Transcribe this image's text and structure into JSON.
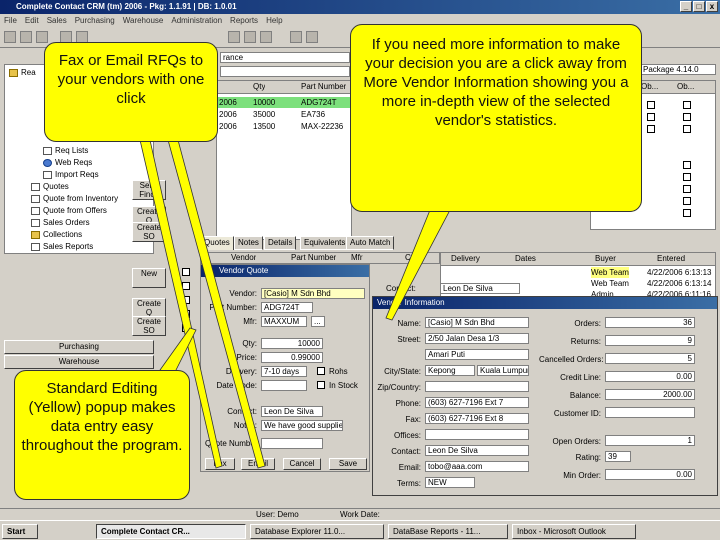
{
  "window": {
    "title": "Complete Contact CRM (tm) 2006 - Pkg: 1.1.91 | DB: 1.0.01",
    "controls": [
      "_",
      "□",
      "x"
    ]
  },
  "menu": [
    "File",
    "Edit",
    "Sales",
    "Purchasing",
    "Warehouse",
    "Administration",
    "Reports",
    "Help"
  ],
  "toolbar_fields": {
    "vendor_filter": "rance",
    "package": "Package 4.14.0"
  },
  "tree": {
    "items": [
      {
        "label": "Rea",
        "icon": "folder"
      },
      {
        "label": "Req Lists",
        "icon": "doc"
      },
      {
        "label": "Web Reqs",
        "icon": "net"
      },
      {
        "label": "Import Reqs",
        "icon": "doc"
      },
      {
        "label": "Quotes",
        "icon": "doc"
      },
      {
        "label": "Quote from Inventory",
        "icon": "doc"
      },
      {
        "label": "Quote from Offers",
        "icon": "doc"
      },
      {
        "label": "Sales Orders",
        "icon": "doc"
      },
      {
        "label": "Collections",
        "icon": "folder"
      },
      {
        "label": "Sales Reports",
        "icon": "doc"
      }
    ]
  },
  "side_buttons": {
    "purchasing": "Purchasing",
    "warehouse": "Warehouse"
  },
  "mid_buttons": [
    "Send Finch",
    "Create Q",
    "Create SO",
    "New",
    "Create Q",
    "Create SO"
  ],
  "grid": {
    "headers": [
      "Qty",
      "Part Number"
    ],
    "rows": [
      {
        "date": "2006",
        "qty": "10000",
        "part": "ADG724T",
        "selected": true
      },
      {
        "date": "2006",
        "qty": "35000",
        "part": "EA736",
        "selected": false
      },
      {
        "date": "2006",
        "qty": "13500",
        "part": "MAX-22236",
        "selected": false
      }
    ]
  },
  "right_grid": {
    "headers": [
      "Ob...",
      "Ob..."
    ]
  },
  "tabs": [
    "Quotes",
    "Notes",
    "Details",
    "Equivalents",
    "Auto Match"
  ],
  "lower_grid": {
    "headers": [
      "Vendor",
      "Part Number",
      "Mfr",
      "Cost",
      "Delivery",
      "Dates",
      "Buyer",
      "Entered"
    ],
    "rows": [
      {
        "buyer": "Web Team",
        "entered": "4/22/2006 6:13:13"
      },
      {
        "buyer": "Web Team",
        "entered": "4/22/2006 6:13:14"
      },
      {
        "buyer": "Admin",
        "entered": "4/22/2006 6:11:16"
      }
    ]
  },
  "vendor_quote": {
    "title": "Vendor Quote",
    "fields": [
      {
        "label": "Vendor:",
        "value": "[Casio] M Sdn Bhd"
      },
      {
        "label": "Part Number:",
        "value": "ADG724T"
      },
      {
        "label": "Mfr:",
        "value": "MAXXUM"
      },
      {
        "label": "Qty:",
        "value": "10000"
      },
      {
        "label": "Price:",
        "value": "0.99000"
      },
      {
        "label": "Delivery:",
        "value": "7-10 days"
      },
      {
        "label": "Date Code:",
        "value": ""
      },
      {
        "label": "Contact:",
        "value": "Leon De Silva"
      },
      {
        "label": "Notes:",
        "value": "We have good supplier"
      },
      {
        "label": "Quote Number:",
        "value": ""
      }
    ],
    "checkbox_labels": [
      "Rohs",
      "In Stock"
    ],
    "buttons": [
      "Fax",
      "Email",
      "Cancel",
      "Save"
    ]
  },
  "vendor_info": {
    "title": "Vendor Information",
    "left_fields": [
      {
        "label": "Name:",
        "value": "[Casio] M Sdn Bhd"
      },
      {
        "label": "Street:",
        "value": "2/50 Jalan Desa 1/3"
      },
      {
        "label": "",
        "value": "Amari Puti"
      },
      {
        "label": "City/State:",
        "value": "Kepong"
      },
      {
        "label": "Zip/Country:",
        "value": ""
      },
      {
        "label": "Phone:",
        "value": "(603) 627-7196 Ext 7"
      },
      {
        "label": "Fax:",
        "value": "(603) 627-7196 Ext 8"
      },
      {
        "label": "Offices:",
        "value": ""
      },
      {
        "label": "Contact:",
        "value": "Leon De Silva"
      },
      {
        "label": "Email:",
        "value": "tobo@aaa.com"
      },
      {
        "label": "Terms:",
        "value": "NEW"
      }
    ],
    "state_value": "Kuala Lumpur",
    "right_fields": [
      {
        "label": "Orders:",
        "value": "36"
      },
      {
        "label": "Returns:",
        "value": "9"
      },
      {
        "label": "Cancelled Orders:",
        "value": "5"
      },
      {
        "label": "Credit Line:",
        "value": "0.00"
      },
      {
        "label": "Balance:",
        "value": "2000.00"
      },
      {
        "label": "Customer ID:",
        "value": ""
      },
      {
        "label": "Open Orders:",
        "value": "1"
      },
      {
        "label": "Rating:",
        "value": "39"
      },
      {
        "label": "Min Order:",
        "value": "0.00"
      }
    ],
    "contact_select": "Leon De Silva",
    "contact_label": "Contact:"
  },
  "callouts": {
    "fax_email": "Fax or Email RFQs to your vendors with one click",
    "more_info": "If you need more information to make your decision you are a click away from More Vendor Information showing you a more in-depth view of the selected vendor's statistics.",
    "editing": "Standard Editing (Yellow) popup makes data entry easy throughout the program."
  },
  "status": {
    "user": "User:  Demo",
    "workdate": "Work Date:"
  },
  "taskbar": {
    "start": "Start",
    "tasks": [
      {
        "label": "Complete Contact CR...",
        "active": true
      },
      {
        "label": "Database Explorer 11.0...",
        "active": false
      },
      {
        "label": "DataBase Reports - 11...",
        "active": false
      },
      {
        "label": "Inbox - Microsoft Outlook",
        "active": false
      }
    ]
  },
  "colors": {
    "highlight_row": "#7ce07c",
    "callout": "#ffff00",
    "title_blue": "#0a246a"
  }
}
